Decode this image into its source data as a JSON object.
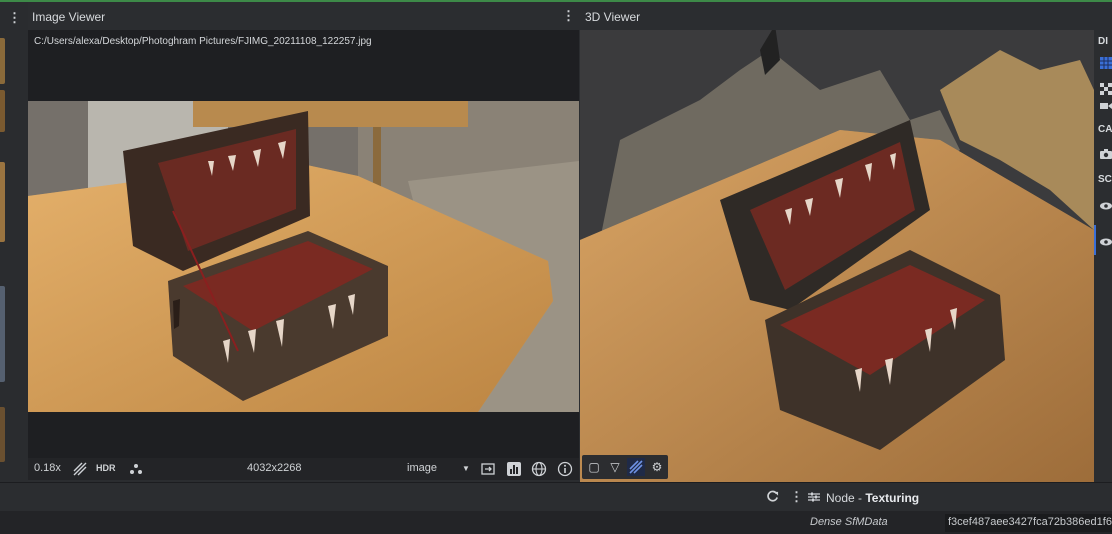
{
  "image_viewer": {
    "title": "Image Viewer",
    "path": "C:/Users/alexa/Desktop/Photoghram Pictures/FJIMG_20211108_122257.jpg",
    "footer": {
      "zoom": "0.18x",
      "hdr_label": "HDR",
      "resolution": "4032x2268",
      "mode_value": "image"
    }
  },
  "viewer_3d": {
    "title": "3D Viewer",
    "side_panel": {
      "headers": [
        "DI",
        "CA",
        "SC"
      ]
    }
  },
  "node_panel": {
    "node_prefix": "Node - ",
    "node_name": "Texturing",
    "attribute": {
      "label": "Dense SfMData",
      "value": "f3cef487aee3427fca72b386ed1f6"
    }
  },
  "colors": {
    "accent_green": "#3d8a48",
    "accent_blue": "#3a6fd8"
  }
}
